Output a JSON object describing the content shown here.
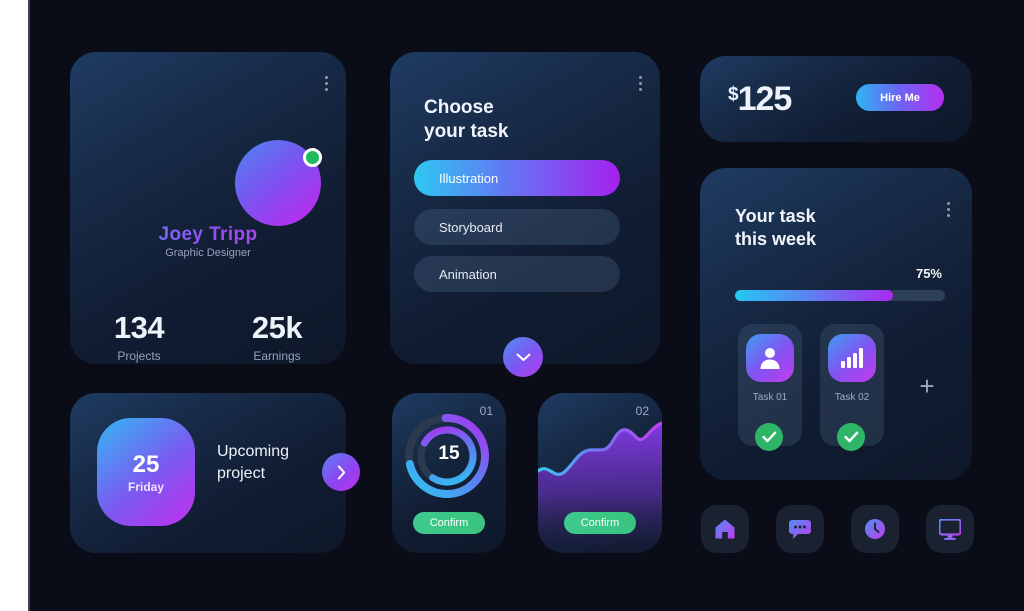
{
  "theme": {
    "background": "#0a0d18",
    "card_bg_top": "#1f3c63",
    "card_bg_bottom": "#0e1729",
    "accent_cyan": "#2ec7f2",
    "accent_purple": "#a520ef",
    "accent_green": "#2eb567",
    "text_primary": "#eef2fa",
    "text_muted": "#98a4bd"
  },
  "profile": {
    "name": "Joey Tripp",
    "role": "Graphic Designer",
    "avatar_icon": "avatar-image",
    "status": "online",
    "menu_icon": "more-vertical-icon",
    "stats": [
      {
        "value": "134",
        "label": "Projects"
      },
      {
        "value": "25k",
        "label": "Earnings"
      }
    ]
  },
  "choose_task": {
    "title_line1": "Choose",
    "title_line2": "your task",
    "menu_icon": "more-vertical-icon",
    "options": [
      {
        "label": "Illustration",
        "selected": true
      },
      {
        "label": "Storyboard",
        "selected": false
      },
      {
        "label": "Animation",
        "selected": false
      }
    ],
    "expand_icon": "chevron-down-icon"
  },
  "price_card": {
    "currency": "$",
    "amount": "125",
    "button_label": "Hire Me"
  },
  "week_task": {
    "title_line1": "Your task",
    "title_line2": "this week",
    "menu_icon": "more-vertical-icon",
    "progress_label": "75%",
    "progress_value": 75,
    "tiles": [
      {
        "label": "Task 01",
        "icon": "user-icon",
        "status_icon": "check-icon",
        "done": true
      },
      {
        "label": "Task 02",
        "icon": "bar-chart-icon",
        "status_icon": "check-icon",
        "done": true
      }
    ],
    "add_label": "+",
    "add_icon": "plus-icon"
  },
  "upcoming": {
    "day": "25",
    "weekday": "Friday",
    "title_line1": "Upcoming",
    "title_line2": "project",
    "next_icon": "chevron-right-icon"
  },
  "mini_cards": [
    {
      "number": "01",
      "center_value": "15",
      "confirm_label": "Confirm",
      "chart_icon": "radial-progress-icon"
    },
    {
      "number": "02",
      "confirm_label": "Confirm",
      "chart_icon": "area-chart-icon"
    }
  ],
  "bottom_nav": [
    {
      "icon": "home-icon",
      "name": "home"
    },
    {
      "icon": "chat-icon",
      "name": "chat"
    },
    {
      "icon": "clock-icon",
      "name": "clock"
    },
    {
      "icon": "monitor-icon",
      "name": "monitor"
    }
  ],
  "chart_data": [
    {
      "type": "pie",
      "title": "01",
      "center_label": "15",
      "series": [
        {
          "name": "outer-ring",
          "value": 72,
          "max": 100,
          "colors": [
            "#2ec7f2",
            "#a520ef"
          ]
        },
        {
          "name": "inner-ring",
          "value": 76,
          "max": 100,
          "colors": [
            "#2ec7f2",
            "#a520ef"
          ]
        }
      ]
    },
    {
      "type": "area",
      "title": "02",
      "x": [
        0,
        1,
        2,
        3,
        4,
        5,
        6,
        7,
        8,
        9,
        10
      ],
      "values": [
        38,
        44,
        35,
        52,
        56,
        54,
        64,
        74,
        70,
        62,
        78
      ],
      "ylim": [
        0,
        100
      ],
      "grid": false,
      "line_colors": [
        "#49c9f5",
        "#b83cef"
      ]
    }
  ]
}
